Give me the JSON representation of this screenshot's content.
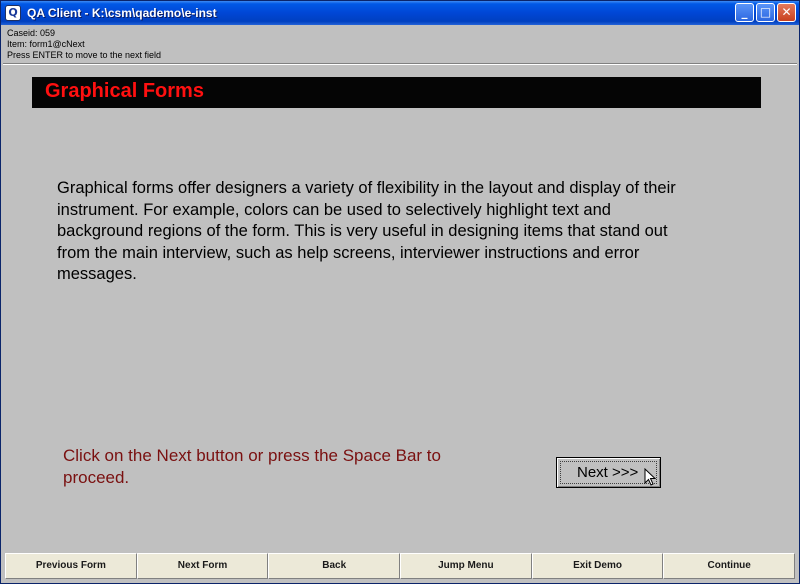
{
  "window": {
    "title": "QA Client - K:\\csm\\qademo\\e-inst",
    "app_icon_glyph": "Q",
    "controls": {
      "minimize": "_",
      "maximize": "□",
      "close": "✕"
    }
  },
  "status": {
    "caseid": "Caseid: 059",
    "item": "Item: form1@cNext",
    "hint": "Press ENTER to move to the next field"
  },
  "form": {
    "title": "Graphical Forms",
    "title_color": "#ff1010",
    "banner_color": "#050505",
    "body": "Graphical forms offer designers a variety of flexibility in the layout and display of their instrument.  For example, colors can be used to selectively highlight text and background regions of the form.  This is very useful in designing items that stand out from the main interview, such as help screens, interviewer instructions and error messages.",
    "instruction": "Click on the Next button or press the Space Bar to proceed.",
    "instruction_color": "#7a1010",
    "next_button_label": "Next >>>"
  },
  "bottom_bar": {
    "previous_form": "Previous Form",
    "next_form": "Next Form",
    "back": "Back",
    "jump_menu": "Jump Menu",
    "exit_demo": "Exit Demo",
    "continue": "Continue"
  },
  "icons": {
    "app": "app-icon",
    "cursor": "mouse-pointer-icon"
  }
}
